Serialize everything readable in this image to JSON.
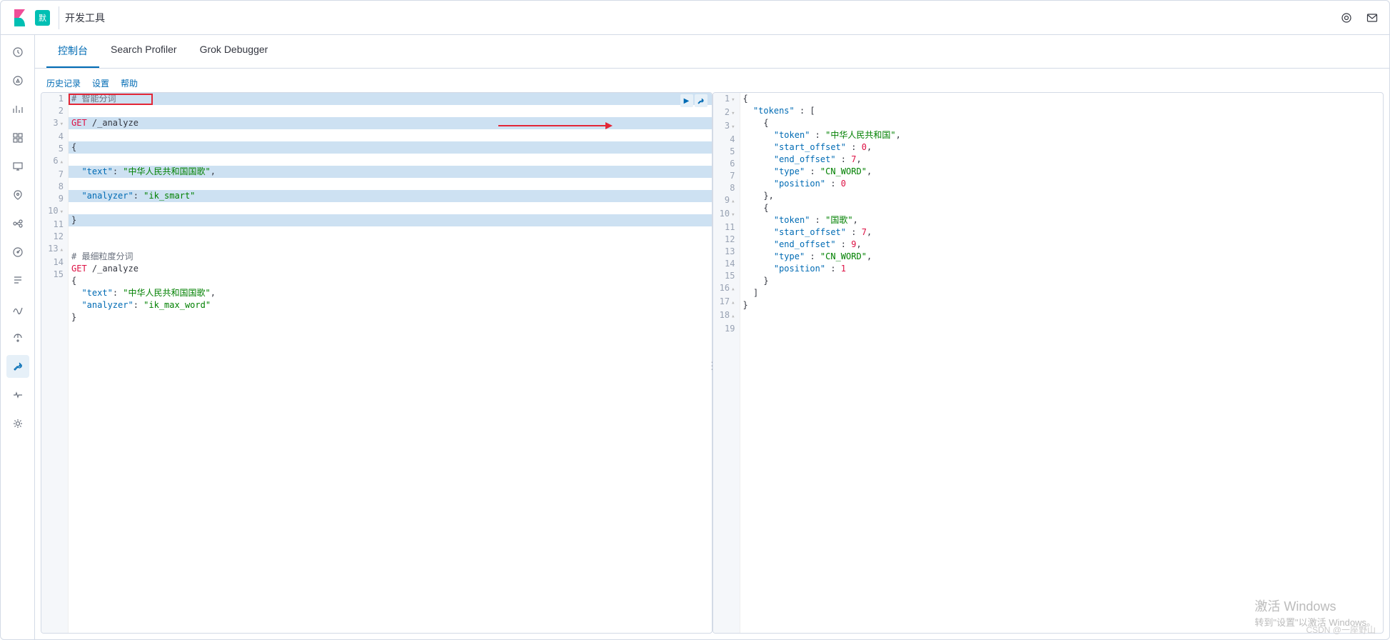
{
  "topbar": {
    "badge": "默",
    "breadcrumb": "开发工具"
  },
  "tabs": {
    "console": "控制台",
    "profiler": "Search Profiler",
    "grok": "Grok Debugger"
  },
  "subtabs": {
    "history": "历史记录",
    "settings": "设置",
    "help": "帮助"
  },
  "editor": {
    "lines": [
      {
        "n": "1",
        "cls": "sel",
        "t": "cmt",
        "txt": "# 智能分词"
      },
      {
        "n": "2",
        "cls": "sel",
        "raw": "<span class='method'>GET</span> /_analyze"
      },
      {
        "n": "3",
        "cls": "sel",
        "txt": "{",
        "fold": "▾"
      },
      {
        "n": "4",
        "cls": "sel",
        "raw": "  <span class='key2'>\"text\"</span>: <span class='str'>\"中华人民共和国国歌\"</span>,"
      },
      {
        "n": "5",
        "cls": "sel",
        "raw": "  <span class='key2'>\"analyzer\"</span>: <span class='str'>\"ik_smart\"</span>"
      },
      {
        "n": "6",
        "cls": "sel",
        "txt": "}",
        "fold": "▴"
      },
      {
        "n": "7",
        "txt": ""
      },
      {
        "n": "8",
        "t": "cmt",
        "txt": "# 最细粒度分词"
      },
      {
        "n": "9",
        "raw": "<span class='method'>GET</span> /_analyze"
      },
      {
        "n": "10",
        "txt": "{",
        "fold": "▾"
      },
      {
        "n": "11",
        "raw": "  <span class='key2'>\"text\"</span>: <span class='str'>\"中华人民共和国国歌\"</span>,"
      },
      {
        "n": "12",
        "raw": "  <span class='key2'>\"analyzer\"</span>: <span class='str'>\"ik_max_word\"</span>"
      },
      {
        "n": "13",
        "txt": "}",
        "fold": "▴"
      },
      {
        "n": "14",
        "txt": ""
      },
      {
        "n": "15",
        "txt": ""
      }
    ]
  },
  "output": {
    "lines": [
      {
        "n": "1",
        "txt": "{",
        "fold": "▾"
      },
      {
        "n": "2",
        "raw": "  <span class='key2'>\"tokens\"</span> : [",
        "fold": "▾"
      },
      {
        "n": "3",
        "txt": "    {",
        "fold": "▾"
      },
      {
        "n": "4",
        "raw": "      <span class='key2'>\"token\"</span> : <span class='str'>\"中华人民共和国\"</span>,"
      },
      {
        "n": "5",
        "raw": "      <span class='key2'>\"start_offset\"</span> : <span class='method'>0</span>,"
      },
      {
        "n": "6",
        "raw": "      <span class='key2'>\"end_offset\"</span> : <span class='method'>7</span>,"
      },
      {
        "n": "7",
        "raw": "      <span class='key2'>\"type\"</span> : <span class='str'>\"CN_WORD\"</span>,"
      },
      {
        "n": "8",
        "raw": "      <span class='key2'>\"position\"</span> : <span class='method'>0</span>"
      },
      {
        "n": "9",
        "txt": "    },",
        "fold": "▴"
      },
      {
        "n": "10",
        "txt": "    {",
        "fold": "▾"
      },
      {
        "n": "11",
        "raw": "      <span class='key2'>\"token\"</span> : <span class='str'>\"国歌\"</span>,"
      },
      {
        "n": "12",
        "raw": "      <span class='key2'>\"start_offset\"</span> : <span class='method'>7</span>,"
      },
      {
        "n": "13",
        "raw": "      <span class='key2'>\"end_offset\"</span> : <span class='method'>9</span>,"
      },
      {
        "n": "14",
        "raw": "      <span class='key2'>\"type\"</span> : <span class='str'>\"CN_WORD\"</span>,"
      },
      {
        "n": "15",
        "raw": "      <span class='key2'>\"position\"</span> : <span class='method'>1</span>"
      },
      {
        "n": "16",
        "txt": "    }",
        "fold": "▴"
      },
      {
        "n": "17",
        "txt": "  ]",
        "fold": "▴"
      },
      {
        "n": "18",
        "txt": "}",
        "fold": "▴"
      },
      {
        "n": "19",
        "txt": ""
      }
    ]
  },
  "watermark": {
    "line1": "激活 Windows",
    "line2": "转到\"设置\"以激活 Windows。"
  },
  "csdn": "CSDN @一座野山"
}
